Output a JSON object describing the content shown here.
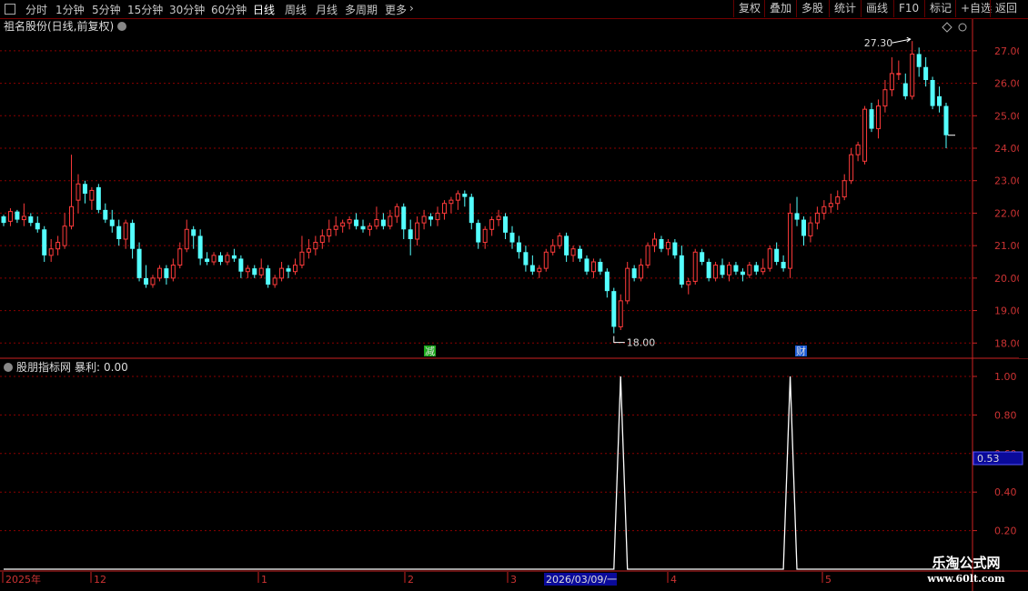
{
  "toolbar": {
    "periods": [
      "分时",
      "1分钟",
      "5分钟",
      "15分钟",
      "30分钟",
      "60分钟",
      "日线",
      "周线",
      "月线",
      "多周期",
      "更多"
    ],
    "active_period": "日线",
    "buttons": [
      "复权",
      "叠加",
      "多股",
      "统计",
      "画线",
      "F10",
      "标记",
      "+自选",
      "返回"
    ]
  },
  "main_title": "祖名股份(日线,前复权)",
  "indicator_title": "股朋指标网",
  "indicator_name": "暴利",
  "indicator_value": "0.00",
  "readout_value": "0.53",
  "annotations": {
    "high": "27.30",
    "low": "18.00",
    "tag1": "减",
    "tag2": "财"
  },
  "date_axis": {
    "labels": [
      "2025年",
      "12",
      "1",
      "2",
      "3",
      "4",
      "5"
    ],
    "selected": "2026/03/09/一"
  },
  "watermark": {
    "line1": "乐淘公式网",
    "line2": "www.60lt.com"
  },
  "colors": {
    "up": "#ff3b3b",
    "down": "#54ffff",
    "grid": "#8b0000",
    "axis": "#cc2222",
    "line": "#ffffff"
  },
  "chart_data": [
    {
      "type": "candlestick",
      "title": "祖名股份(日线,前复权)",
      "ylim": [
        17.7,
        27.5
      ],
      "yticks": [
        18.0,
        19.0,
        20.0,
        21.0,
        22.0,
        23.0,
        24.0,
        25.0,
        26.0,
        27.0
      ],
      "ohlc": [
        [
          21.9,
          21.95,
          21.6,
          21.7
        ],
        [
          21.75,
          22.15,
          21.6,
          22.05
        ],
        [
          22.05,
          22.1,
          21.7,
          21.8
        ],
        [
          21.8,
          22.3,
          21.6,
          21.9
        ],
        [
          21.9,
          22.0,
          21.6,
          21.7
        ],
        [
          21.7,
          21.9,
          21.4,
          21.5
        ],
        [
          21.5,
          21.6,
          20.5,
          20.7
        ],
        [
          20.7,
          21.2,
          20.5,
          20.9
        ],
        [
          20.9,
          21.3,
          20.7,
          21.1
        ],
        [
          21.0,
          22.0,
          20.9,
          21.6
        ],
        [
          21.6,
          23.8,
          21.5,
          22.2
        ],
        [
          22.4,
          23.2,
          22.0,
          22.9
        ],
        [
          22.9,
          23.0,
          22.3,
          22.6
        ],
        [
          22.4,
          22.8,
          22.1,
          22.7
        ],
        [
          22.8,
          22.9,
          22.0,
          22.1
        ],
        [
          22.1,
          22.3,
          21.7,
          21.8
        ],
        [
          21.8,
          22.1,
          21.4,
          21.6
        ],
        [
          21.6,
          21.8,
          21.0,
          21.2
        ],
        [
          21.2,
          21.8,
          20.9,
          21.7
        ],
        [
          21.7,
          21.8,
          20.6,
          20.9
        ],
        [
          20.9,
          21.1,
          19.9,
          20.0
        ],
        [
          20.0,
          20.4,
          19.7,
          19.8
        ],
        [
          19.8,
          20.1,
          19.7,
          20.0
        ],
        [
          20.0,
          20.4,
          19.9,
          20.3
        ],
        [
          20.3,
          20.4,
          19.8,
          20.0
        ],
        [
          20.0,
          20.6,
          19.9,
          20.4
        ],
        [
          20.4,
          21.1,
          20.3,
          20.9
        ],
        [
          20.9,
          21.8,
          20.8,
          21.5
        ],
        [
          21.5,
          21.6,
          20.9,
          21.3
        ],
        [
          21.3,
          21.5,
          20.4,
          20.6
        ],
        [
          20.6,
          20.8,
          20.4,
          20.5
        ],
        [
          20.5,
          20.8,
          20.4,
          20.7
        ],
        [
          20.7,
          20.8,
          20.4,
          20.5
        ],
        [
          20.5,
          20.8,
          20.4,
          20.7
        ],
        [
          20.7,
          20.9,
          20.5,
          20.6
        ],
        [
          20.6,
          20.7,
          20.0,
          20.2
        ],
        [
          20.2,
          20.4,
          20.0,
          20.3
        ],
        [
          20.3,
          20.4,
          20.0,
          20.1
        ],
        [
          20.1,
          20.6,
          20.0,
          20.3
        ],
        [
          20.3,
          20.4,
          19.7,
          19.8
        ],
        [
          19.8,
          20.1,
          19.7,
          20.0
        ],
        [
          20.0,
          20.5,
          19.9,
          20.3
        ],
        [
          20.3,
          20.4,
          20.0,
          20.2
        ],
        [
          20.2,
          20.6,
          20.1,
          20.4
        ],
        [
          20.4,
          21.3,
          20.3,
          20.8
        ],
        [
          20.8,
          21.2,
          20.6,
          20.9
        ],
        [
          20.9,
          21.3,
          20.7,
          21.1
        ],
        [
          21.1,
          21.5,
          20.9,
          21.3
        ],
        [
          21.3,
          21.8,
          21.1,
          21.5
        ],
        [
          21.5,
          21.9,
          21.3,
          21.6
        ],
        [
          21.6,
          21.8,
          21.4,
          21.7
        ],
        [
          21.7,
          21.9,
          21.5,
          21.8
        ],
        [
          21.8,
          22.0,
          21.5,
          21.6
        ],
        [
          21.6,
          21.8,
          21.4,
          21.5
        ],
        [
          21.5,
          21.7,
          21.3,
          21.6
        ],
        [
          21.6,
          22.2,
          21.5,
          21.8
        ],
        [
          21.8,
          22.0,
          21.5,
          21.6
        ],
        [
          21.6,
          22.1,
          21.5,
          21.9
        ],
        [
          21.9,
          22.3,
          21.7,
          22.2
        ],
        [
          22.2,
          22.3,
          21.2,
          21.5
        ],
        [
          21.5,
          21.8,
          20.7,
          21.2
        ],
        [
          21.2,
          21.9,
          21.0,
          21.7
        ],
        [
          21.7,
          22.1,
          21.5,
          21.9
        ],
        [
          21.9,
          22.0,
          21.6,
          21.8
        ],
        [
          21.8,
          22.2,
          21.6,
          22.0
        ],
        [
          22.0,
          22.4,
          21.8,
          22.3
        ],
        [
          22.3,
          22.5,
          22.0,
          22.4
        ],
        [
          22.4,
          22.7,
          22.1,
          22.6
        ],
        [
          22.6,
          22.7,
          22.2,
          22.5
        ],
        [
          22.5,
          22.6,
          21.5,
          21.7
        ],
        [
          21.7,
          21.8,
          20.9,
          21.1
        ],
        [
          21.1,
          21.6,
          20.9,
          21.5
        ],
        [
          21.5,
          21.9,
          21.3,
          21.8
        ],
        [
          21.8,
          22.1,
          21.6,
          21.9
        ],
        [
          21.9,
          22.0,
          21.2,
          21.4
        ],
        [
          21.4,
          21.6,
          20.9,
          21.1
        ],
        [
          21.1,
          21.3,
          20.6,
          20.8
        ],
        [
          20.8,
          21.0,
          20.2,
          20.4
        ],
        [
          20.4,
          20.7,
          20.1,
          20.2
        ],
        [
          20.2,
          20.4,
          20.0,
          20.3
        ],
        [
          20.3,
          20.9,
          20.2,
          20.8
        ],
        [
          20.8,
          21.2,
          20.7,
          21.0
        ],
        [
          21.0,
          21.4,
          20.9,
          21.3
        ],
        [
          21.3,
          21.4,
          20.5,
          20.7
        ],
        [
          20.7,
          21.0,
          20.5,
          20.9
        ],
        [
          20.9,
          21.0,
          20.5,
          20.6
        ],
        [
          20.6,
          20.7,
          20.1,
          20.2
        ],
        [
          20.2,
          20.6,
          20.0,
          20.5
        ],
        [
          20.5,
          20.6,
          20.1,
          20.2
        ],
        [
          20.2,
          20.3,
          19.4,
          19.6
        ],
        [
          19.6,
          19.7,
          18.3,
          18.5
        ],
        [
          18.5,
          19.5,
          18.4,
          19.3
        ],
        [
          19.3,
          20.5,
          19.2,
          20.3
        ],
        [
          20.3,
          20.4,
          19.9,
          20.0
        ],
        [
          20.0,
          20.6,
          19.9,
          20.4
        ],
        [
          20.4,
          21.1,
          20.3,
          21.0
        ],
        [
          21.0,
          21.4,
          20.8,
          21.2
        ],
        [
          21.2,
          21.3,
          20.8,
          20.9
        ],
        [
          20.9,
          21.2,
          20.7,
          21.1
        ],
        [
          21.1,
          21.2,
          20.6,
          20.7
        ],
        [
          20.7,
          21.0,
          19.7,
          19.8
        ],
        [
          19.8,
          20.0,
          19.5,
          19.9
        ],
        [
          19.9,
          20.9,
          19.8,
          20.8
        ],
        [
          20.8,
          20.9,
          20.4,
          20.5
        ],
        [
          20.5,
          20.6,
          19.9,
          20.0
        ],
        [
          20.0,
          20.5,
          19.9,
          20.4
        ],
        [
          20.4,
          20.6,
          20.0,
          20.1
        ],
        [
          20.1,
          20.5,
          19.9,
          20.4
        ],
        [
          20.4,
          20.5,
          20.1,
          20.2
        ],
        [
          20.2,
          20.3,
          19.9,
          20.1
        ],
        [
          20.1,
          20.5,
          20.0,
          20.4
        ],
        [
          20.4,
          20.5,
          20.1,
          20.2
        ],
        [
          20.2,
          20.6,
          20.1,
          20.3
        ],
        [
          20.3,
          21.0,
          20.2,
          20.9
        ],
        [
          20.9,
          21.1,
          20.4,
          20.5
        ],
        [
          20.5,
          20.7,
          20.2,
          20.3
        ],
        [
          20.3,
          22.3,
          20.0,
          22.0
        ],
        [
          22.0,
          22.5,
          21.6,
          21.8
        ],
        [
          21.8,
          21.9,
          21.0,
          21.3
        ],
        [
          21.3,
          21.9,
          21.1,
          21.7
        ],
        [
          21.7,
          22.2,
          21.5,
          22.0
        ],
        [
          22.0,
          22.4,
          21.8,
          22.2
        ],
        [
          22.2,
          22.6,
          22.0,
          22.3
        ],
        [
          22.3,
          22.7,
          22.1,
          22.5
        ],
        [
          22.5,
          23.2,
          22.4,
          23.0
        ],
        [
          23.0,
          24.0,
          22.9,
          23.8
        ],
        [
          23.8,
          24.2,
          23.6,
          24.1
        ],
        [
          23.6,
          25.3,
          23.5,
          25.2
        ],
        [
          25.2,
          25.4,
          24.5,
          24.6
        ],
        [
          24.6,
          25.5,
          24.3,
          25.3
        ],
        [
          25.3,
          26.1,
          25.1,
          25.8
        ],
        [
          25.8,
          26.8,
          25.6,
          26.3
        ],
        [
          26.3,
          26.7,
          26.1,
          26.3
        ],
        [
          26.0,
          26.3,
          25.5,
          25.6
        ],
        [
          25.6,
          27.3,
          25.5,
          26.9
        ],
        [
          26.9,
          27.1,
          26.2,
          26.5
        ],
        [
          26.5,
          26.8,
          25.9,
          26.1
        ],
        [
          26.1,
          26.2,
          25.2,
          25.3
        ],
        [
          25.6,
          25.9,
          25.1,
          25.3
        ],
        [
          25.3,
          25.4,
          24.0,
          24.4
        ]
      ]
    },
    {
      "type": "line",
      "title": "股朋指标网",
      "series": [
        {
          "name": "暴利",
          "values": [
            0,
            0,
            0,
            0,
            0,
            0,
            0,
            0,
            0,
            0,
            0,
            0,
            0,
            0,
            0,
            0,
            0,
            0,
            0,
            0,
            0,
            0,
            0,
            0,
            0,
            0,
            0,
            0,
            0,
            0,
            0,
            0,
            0,
            0,
            0,
            0,
            0,
            0,
            0,
            0,
            0,
            0,
            0,
            0,
            0,
            0,
            0,
            0,
            0,
            0,
            0,
            0,
            0,
            0,
            0,
            0,
            0,
            0,
            0,
            0,
            0,
            0,
            0,
            0,
            0,
            0,
            0,
            0,
            0,
            0,
            0,
            0,
            0,
            0,
            0,
            0,
            0,
            0,
            0,
            0,
            0,
            0,
            0,
            0,
            0,
            0,
            0,
            0,
            0,
            0,
            0,
            1,
            0,
            0,
            0,
            0,
            0,
            0,
            0,
            0,
            0,
            0,
            0,
            0,
            0,
            0,
            0,
            0,
            0,
            0,
            0,
            0,
            0,
            0,
            0,
            0,
            1,
            0,
            0,
            0,
            0,
            0,
            0,
            0,
            0,
            0,
            0,
            0,
            0,
            0,
            0,
            0,
            0,
            0,
            0,
            0,
            0,
            0,
            0,
            0,
            0,
            0
          ]
        }
      ],
      "ylim": [
        0,
        1.05
      ],
      "yticks": [
        0.2,
        0.4,
        0.6,
        0.8,
        1.0
      ]
    }
  ]
}
